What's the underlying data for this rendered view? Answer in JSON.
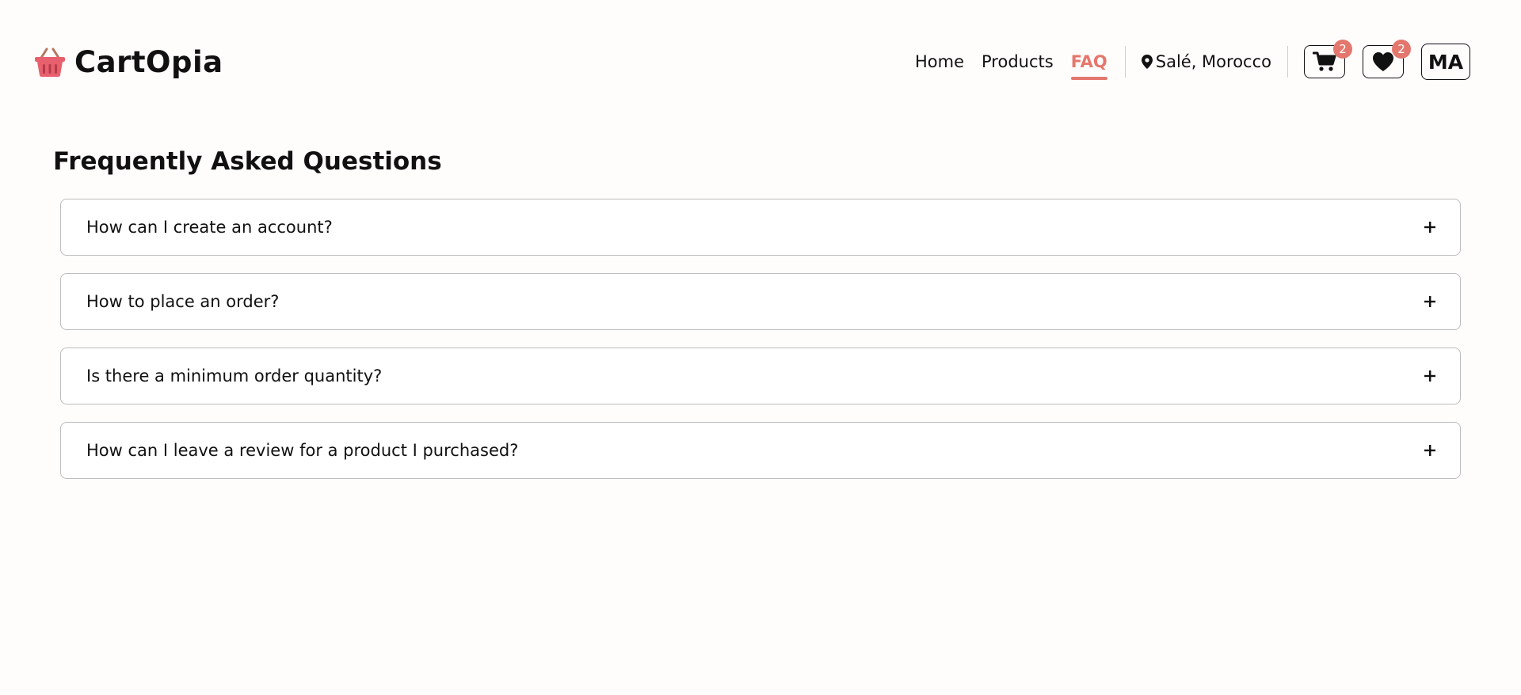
{
  "brand": {
    "name": "CartOpia",
    "logo_icon": "basket-icon"
  },
  "nav": {
    "links": [
      {
        "label": "Home",
        "active": false
      },
      {
        "label": "Products",
        "active": false
      },
      {
        "label": "FAQ",
        "active": true
      }
    ],
    "location": "Salé, Morocco",
    "location_icon": "map-pin-icon"
  },
  "actions": {
    "cart": {
      "icon": "cart-icon",
      "count": "2"
    },
    "wishlist": {
      "icon": "heart-icon",
      "count": "2"
    },
    "avatar_initials": "MA"
  },
  "page": {
    "title": "Frequently Asked Questions"
  },
  "faq": {
    "items": [
      {
        "question": "How can I create an account?",
        "toggle_icon": "plus-icon"
      },
      {
        "question": "How to place an order?",
        "toggle_icon": "plus-icon"
      },
      {
        "question": "Is there a minimum order quantity?",
        "toggle_icon": "plus-icon"
      },
      {
        "question": "How can I leave a review for a product I purchased?",
        "toggle_icon": "plus-icon"
      }
    ]
  },
  "colors": {
    "accent": "#e4776d",
    "background": "#fffcfc",
    "text": "#111111",
    "border": "#bdbdbd"
  }
}
